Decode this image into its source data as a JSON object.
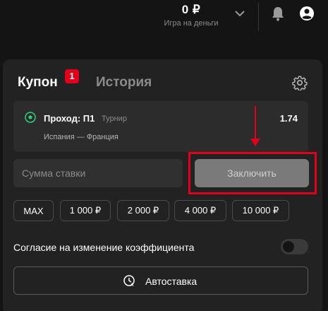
{
  "header": {
    "balance": "0 ₽",
    "balance_label": "Игра на деньги",
    "icons": [
      "chevron-down-icon",
      "bell-icon",
      "user-icon"
    ]
  },
  "tabs": {
    "coupon": "Купон",
    "coupon_badge": "1",
    "history": "История",
    "settings_icon": "gear-icon"
  },
  "bet": {
    "title": "Проход: П1",
    "tag": "Турнир",
    "odds": "1.74",
    "match": "Испания — Франция",
    "icon": "soccer-ball-icon"
  },
  "stake": {
    "placeholder": "Сумма ставки",
    "submit_label": "Заключить"
  },
  "quick_amounts": [
    "MAX",
    "1 000 ₽",
    "2 000 ₽",
    "4 000 ₽",
    "10 000 ₽"
  ],
  "consent": {
    "label": "Согласие на изменение коэффициента",
    "enabled": false
  },
  "autostake": {
    "label": "Автоставка",
    "icon": "auto-clock-icon"
  },
  "colors": {
    "accent_red": "#e2001a",
    "panel_bg": "#222222",
    "page_bg": "#141414",
    "ball_green": "#2fd07a"
  }
}
